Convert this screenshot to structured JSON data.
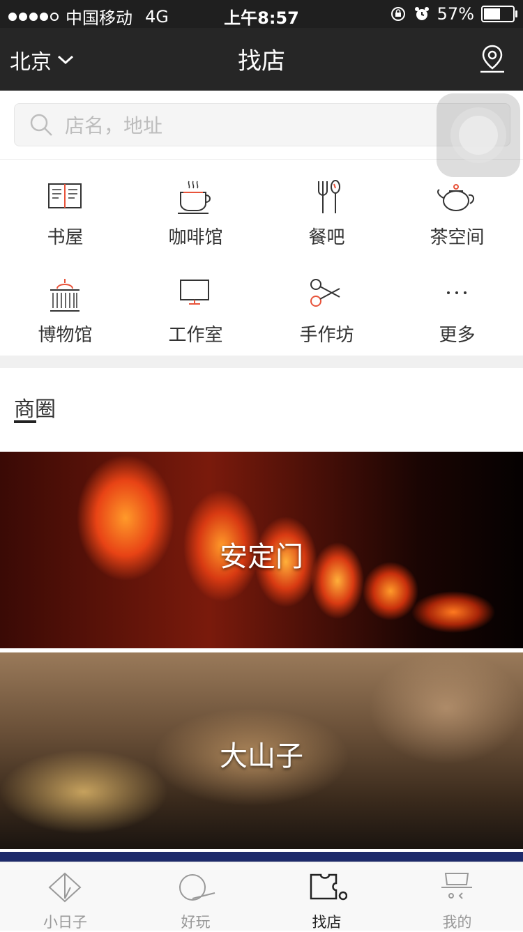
{
  "status_bar": {
    "carrier": "中国移动",
    "network": "4G",
    "time": "上午8:57",
    "battery": "57%",
    "battery_level": 0.57
  },
  "nav": {
    "city": "北京",
    "title": "找店",
    "location_icon": "map-pin-icon"
  },
  "search": {
    "placeholder": "店名，地址",
    "value": ""
  },
  "categories": [
    {
      "label": "书屋",
      "icon": "book-icon"
    },
    {
      "label": "咖啡馆",
      "icon": "coffee-cup-icon"
    },
    {
      "label": "餐吧",
      "icon": "fork-spoon-icon"
    },
    {
      "label": "茶空间",
      "icon": "teapot-icon"
    },
    {
      "label": "博物馆",
      "icon": "museum-icon"
    },
    {
      "label": "工作室",
      "icon": "monitor-icon"
    },
    {
      "label": "手作坊",
      "icon": "scissors-icon"
    },
    {
      "label": "更多",
      "icon": "more-icon"
    }
  ],
  "section": {
    "title": "商圈"
  },
  "districts": [
    {
      "name": "安定门"
    },
    {
      "name": "大山子"
    }
  ],
  "tabs": [
    {
      "label": "小日子",
      "icon": "diamond-icon",
      "active": false
    },
    {
      "label": "好玩",
      "icon": "circle-icon",
      "active": false
    },
    {
      "label": "找店",
      "icon": "store-icon",
      "active": true
    },
    {
      "label": "我的",
      "icon": "profile-icon",
      "active": false
    }
  ],
  "colors": {
    "nav_background": "#262626",
    "accent": "#e8533a"
  }
}
